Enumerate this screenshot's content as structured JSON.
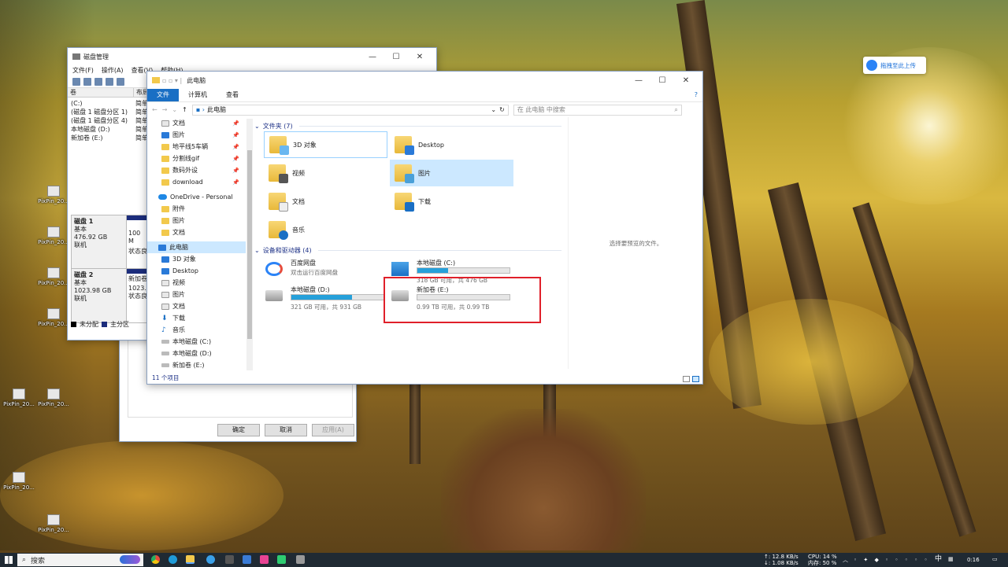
{
  "desktop": {
    "icon_labels": [
      "PixPin_20...",
      "PixPin_20...",
      "PixPin_20...",
      "PixPin_20...",
      "PixPin_20...",
      "PixPin_20...",
      "PixPin_20...",
      "PixPin_20..."
    ],
    "baidu_float_label": "拖拽至此上传"
  },
  "disk_mgmt": {
    "title": "磁盘管理",
    "menu": [
      "文件(F)",
      "操作(A)",
      "查看(V)",
      "帮助(H)"
    ],
    "columns": [
      "卷",
      "布局"
    ],
    "volumes": [
      {
        "name": "(C:)",
        "layout": "简单"
      },
      {
        "name": "(磁盘 1 磁盘分区 1)",
        "layout": "简单"
      },
      {
        "name": "(磁盘 1 磁盘分区 4)",
        "layout": "简单"
      },
      {
        "name": "本地磁盘 (D:)",
        "layout": "简单"
      },
      {
        "name": "新加卷 (E:)",
        "layout": "简单"
      }
    ],
    "disks": [
      {
        "name": "磁盘 1",
        "type": "基本",
        "size": "476.92 GB",
        "status": "联机",
        "part_size": "100 M",
        "part_status": "状态良"
      },
      {
        "name": "磁盘 2",
        "type": "基本",
        "size": "1023.98 GB",
        "status": "联机",
        "part_name": "新加卷",
        "part_size": "1023.9",
        "part_status": "状态良"
      }
    ],
    "legend": [
      "未分配",
      "主分区"
    ]
  },
  "dialog": {
    "ok": "确定",
    "cancel": "取消",
    "apply": "应用(A)"
  },
  "explorer": {
    "title": "此电脑",
    "tabs": [
      "文件",
      "计算机",
      "查看"
    ],
    "address": "此电脑",
    "search_placeholder": "在 此电脑 中搜索",
    "nav": [
      {
        "label": "文档",
        "pin": true
      },
      {
        "label": "图片",
        "pin": true
      },
      {
        "label": "地平线5车辆",
        "pin": true
      },
      {
        "label": "分割线gif",
        "pin": true
      },
      {
        "label": "数码外设",
        "pin": true
      },
      {
        "label": "download",
        "pin": true
      },
      {
        "label": "OneDrive - Personal",
        "pin": false
      },
      {
        "label": "附件",
        "pin": false
      },
      {
        "label": "图片",
        "pin": false
      },
      {
        "label": "文档",
        "pin": false
      },
      {
        "label": "此电脑",
        "pin": false
      },
      {
        "label": "3D 对象",
        "pin": false
      },
      {
        "label": "Desktop",
        "pin": false
      },
      {
        "label": "视频",
        "pin": false
      },
      {
        "label": "图片",
        "pin": false
      },
      {
        "label": "文档",
        "pin": false
      },
      {
        "label": "下载",
        "pin": false
      },
      {
        "label": "音乐",
        "pin": false
      },
      {
        "label": "本地磁盘 (C:)",
        "pin": false
      },
      {
        "label": "本地磁盘 (D:)",
        "pin": false
      },
      {
        "label": "新加卷 (E:)",
        "pin": false
      }
    ],
    "folders_header": "文件夹 (7)",
    "folders": [
      "3D 对象",
      "Desktop",
      "视频",
      "图片",
      "文档",
      "下载",
      "音乐"
    ],
    "devices_header": "设备和驱动器 (4)",
    "devices": [
      {
        "name": "百度网盘",
        "sub": "双击运行百度网盘"
      },
      {
        "name": "本地磁盘 (C:)",
        "size": "318 GB 可用，共 476 GB",
        "used": 0.33
      },
      {
        "name": "本地磁盘 (D:)",
        "size": "321 GB 可用，共 931 GB",
        "used": 0.66
      },
      {
        "name": "新加卷 (E:)",
        "size": "0.99 TB 可用，共 0.99 TB",
        "used": 0.0
      }
    ],
    "preview_hint": "选择要预览的文件。",
    "status": "11 个项目",
    "selected_color": "#cce8ff",
    "accent": "#1a6fc4",
    "highlight_color": "#e0202a"
  },
  "taskbar": {
    "search": "搜索",
    "net_up": "↑: 12.8 KB/s",
    "net_down": "↓: 1.08 KB/s",
    "cpu": "CPU: 14 %",
    "mem": "内存: 50 %",
    "ime": "中",
    "time": "0:16"
  }
}
